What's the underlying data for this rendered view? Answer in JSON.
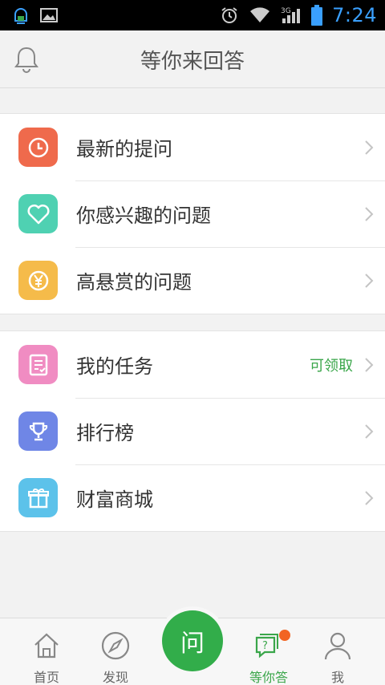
{
  "status_bar": {
    "time": "7:24",
    "network": "3G"
  },
  "header": {
    "title": "等你来回答",
    "left_icon": "bell-icon"
  },
  "groups": [
    {
      "items": [
        {
          "label": "最新的提问",
          "icon": "clock-icon",
          "color": "#ef6a4c"
        },
        {
          "label": "你感兴趣的问题",
          "icon": "heart-icon",
          "color": "#4fd1b2"
        },
        {
          "label": "高悬赏的问题",
          "icon": "yen-icon",
          "color": "#f5bb4a"
        }
      ]
    },
    {
      "items": [
        {
          "label": "我的任务",
          "icon": "task-list-icon",
          "color": "#f08cc2",
          "badge": "可领取"
        },
        {
          "label": "排行榜",
          "icon": "trophy-icon",
          "color": "#6f86e6"
        },
        {
          "label": "财富商城",
          "icon": "gift-icon",
          "color": "#5cc2ea"
        }
      ]
    }
  ],
  "bottom_nav": {
    "items": [
      {
        "label": "首页",
        "icon": "home-icon"
      },
      {
        "label": "发现",
        "icon": "compass-icon"
      },
      {
        "label": "问",
        "icon": "ask-button"
      },
      {
        "label": "等你答",
        "icon": "answer-bubble-icon",
        "active": true
      },
      {
        "label": "我",
        "icon": "person-icon"
      }
    ]
  },
  "colors": {
    "accent_green": "#32ad4a",
    "badge_green": "#3aa64a",
    "notify_orange": "#f26422",
    "time_blue": "#3aa0ff"
  }
}
